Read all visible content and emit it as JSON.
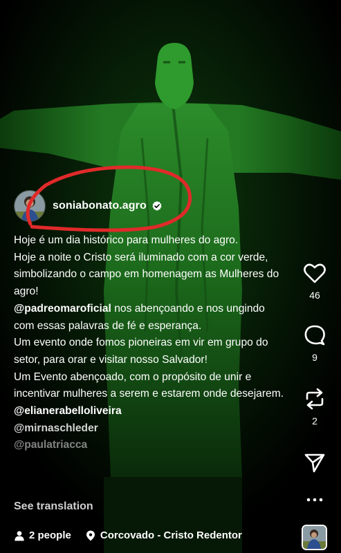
{
  "post": {
    "username": "soniabonato.agro",
    "caption_lines": [
      "Hoje é um dia histórico para mulheres do agro.",
      "Hoje a noite o Cristo será iluminado com a cor verde, simbolizando o campo em homenagem as Mulheres do agro!",
      "@padreomaroficial",
      "nos abençoando e nos ungindo com essas palavras de fé e esperança.",
      "Um evento onde fomos pioneiras em vir em grupo do setor, para orar e visitar nosso Salvador!",
      "Um Evento abençoado, com o propósito de unir e incentivar mulheres a serem e estarem onde desejarem."
    ],
    "mentions": [
      "@elianerabelloliveira",
      "@mirnaschleder",
      "@paulatriacca"
    ],
    "see_translation": "See translation",
    "people": "2 people",
    "location": "Corcovado - Cristo Redentor"
  },
  "actions": {
    "likes": "46",
    "comments": "9",
    "reposts": "2"
  },
  "colors": {
    "statue": "#1f7d1f",
    "annotation": "#e02a2a"
  },
  "icons": [
    "verified-badge-icon",
    "heart-icon",
    "comment-icon",
    "repost-icon",
    "share-icon",
    "more-icon",
    "people-icon",
    "location-pin-icon"
  ]
}
